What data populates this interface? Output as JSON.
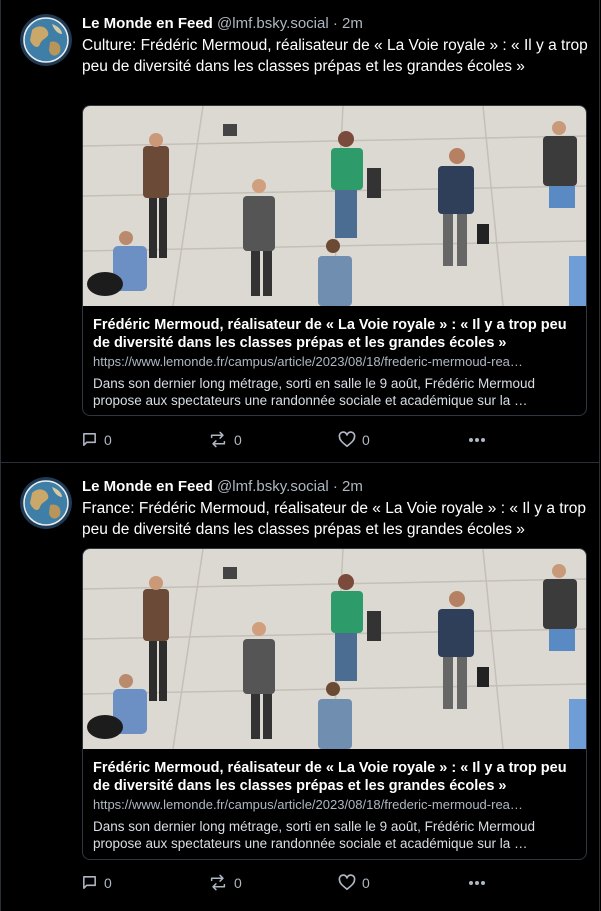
{
  "posts": [
    {
      "author_name": "Le Monde en Feed",
      "handle": "@lmf.bsky.social",
      "separator": "·",
      "time": "2m",
      "text": "Culture: Frédéric Mermoud, réalisateur de « La Voie royale » : « Il y a trop peu de diversité dans les classes prépas et les grandes écoles »",
      "card": {
        "title": "Frédéric Mermoud, réalisateur de « La Voie royale » : « Il y a trop peu de diversité dans les classes prépas et les grandes écoles »",
        "url": "https://www.lemonde.fr/campus/article/2023/08/18/frederic-mermoud-rea…",
        "description": "Dans son dernier long métrage, sorti en salle le 9 août, Frédéric Mermoud propose aux spectateurs une randonnée sociale et académique sur la …"
      },
      "replies": "0",
      "reposts": "0",
      "likes": "0"
    },
    {
      "author_name": "Le Monde en Feed",
      "handle": "@lmf.bsky.social",
      "separator": "·",
      "time": "2m",
      "text": "France: Frédéric Mermoud, réalisateur de « La Voie royale » : « Il y a trop peu de diversité dans les classes prépas et les grandes écoles »",
      "card": {
        "title": "Frédéric Mermoud, réalisateur de « La Voie royale » : « Il y a trop peu de diversité dans les classes prépas et les grandes écoles »",
        "url": "https://www.lemonde.fr/campus/article/2023/08/18/frederic-mermoud-rea…",
        "description": "Dans son dernier long métrage, sorti en salle le 9 août, Frédéric Mermoud propose aux spectateurs une randonnée sociale et académique sur la …"
      },
      "replies": "0",
      "reposts": "0",
      "likes": "0"
    }
  ],
  "icons": {
    "reply": "reply-icon",
    "repost": "repost-icon",
    "like": "heart-icon",
    "more": "more-icon",
    "avatar": "globe-icon"
  },
  "colors": {
    "background": "#000000",
    "muted_text": "#aeb7c2",
    "border": "#2a2f36"
  }
}
